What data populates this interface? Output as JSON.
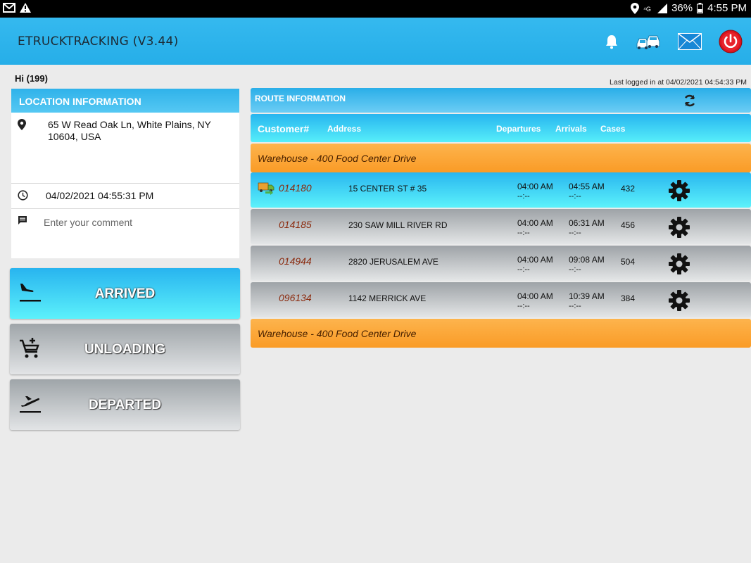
{
  "statusbar": {
    "battery": "36%",
    "time": "4:55 PM"
  },
  "header": {
    "title": "ETRUCKTRACKING (V3.44)",
    "icons": [
      "bell-icon",
      "cars-icon",
      "mail-icon",
      "power-icon"
    ]
  },
  "greeting": "Hi (199)",
  "last_login": "Last logged in at 04/02/2021 04:54:33 PM",
  "location": {
    "header": "LOCATION INFORMATION",
    "address": "65 W Read Oak Ln, White Plains, NY 10604, USA",
    "datetime": "04/02/2021 04:55:31 PM",
    "comment_placeholder": "Enter your comment",
    "comment_value": ""
  },
  "actions": {
    "arrived": "ARRIVED",
    "unloading": "UNLOADING",
    "departed": "DEPARTED"
  },
  "route": {
    "header": "ROUTE INFORMATION",
    "columns": {
      "customer": "Customer#",
      "address": "Address",
      "departures": "Departures",
      "arrivals": "Arrivals",
      "cases": "Cases"
    },
    "warehouse_start": "Warehouse - 400 Food Center Drive",
    "warehouse_end": "Warehouse - 400 Food Center Drive",
    "stops": [
      {
        "customer": "014180",
        "address": "15 CENTER ST # 35",
        "departure": "04:00 AM",
        "departure_actual": "--:--",
        "arrival": "04:55 AM",
        "arrival_actual": "--:--",
        "cases": "432",
        "active": true
      },
      {
        "customer": "014185",
        "address": "230 SAW MILL RIVER RD",
        "departure": "04:00 AM",
        "departure_actual": "--:--",
        "arrival": "06:31 AM",
        "arrival_actual": "--:--",
        "cases": "456",
        "active": false
      },
      {
        "customer": "014944",
        "address": "2820 JERUSALEM AVE",
        "departure": "04:00 AM",
        "departure_actual": "--:--",
        "arrival": "09:08 AM",
        "arrival_actual": "--:--",
        "cases": "504",
        "active": false
      },
      {
        "customer": "096134",
        "address": "1142 MERRICK AVE",
        "departure": "04:00 AM",
        "departure_actual": "--:--",
        "arrival": "10:39 AM",
        "arrival_actual": "--:--",
        "cases": "384",
        "active": false
      }
    ]
  },
  "colors": {
    "app_blue": "#26aee8",
    "cyan_active": "#5cf1fb",
    "warehouse_orange": "#fa9b26",
    "customer_red": "#8b2a0e",
    "power_red": "#d9141e"
  }
}
